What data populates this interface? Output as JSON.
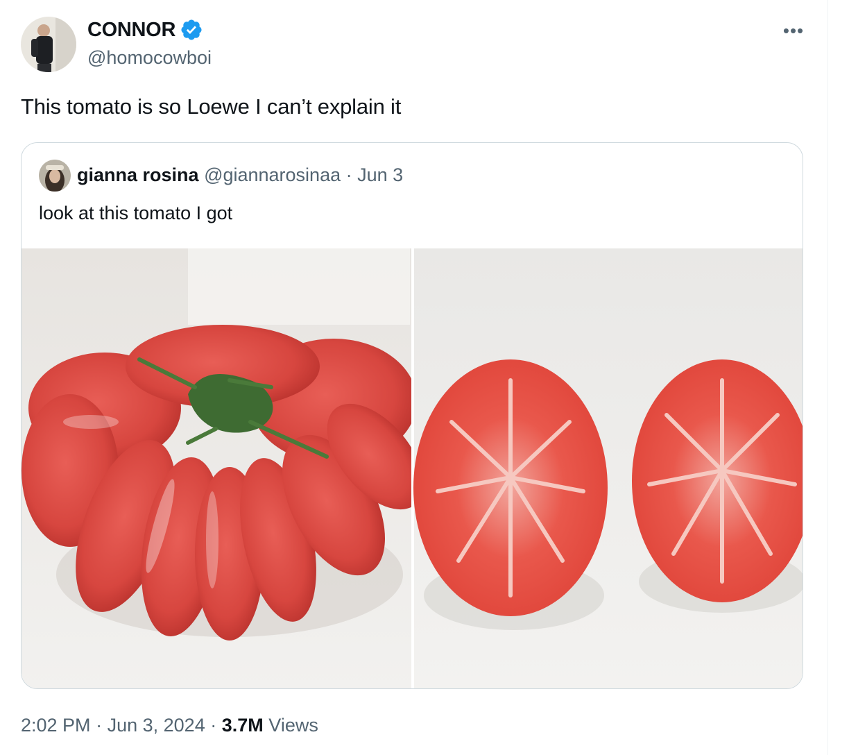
{
  "author": {
    "display_name": "CONNOR",
    "handle": "@homocowboi",
    "verified": true,
    "avatar_icon": "profile-photo"
  },
  "tweet": {
    "text": "This tomato is so Loewe I can’t explain it"
  },
  "quoted_tweet": {
    "display_name": "gianna rosina",
    "handle": "@giannarosinaa",
    "separator": "·",
    "date": "Jun 3",
    "text": "look at this tomato I got",
    "images": [
      "whole ribbed tomato photo",
      "sliced tomato halves photo"
    ]
  },
  "footer": {
    "time": "2:02 PM",
    "sep1": "·",
    "date": "Jun 3, 2024",
    "sep2": "·",
    "views_count": "3.7M",
    "views_label": "Views"
  },
  "colors": {
    "verified_blue": "#1d9bf0",
    "secondary_text": "#536471",
    "border": "#cfd9de"
  }
}
